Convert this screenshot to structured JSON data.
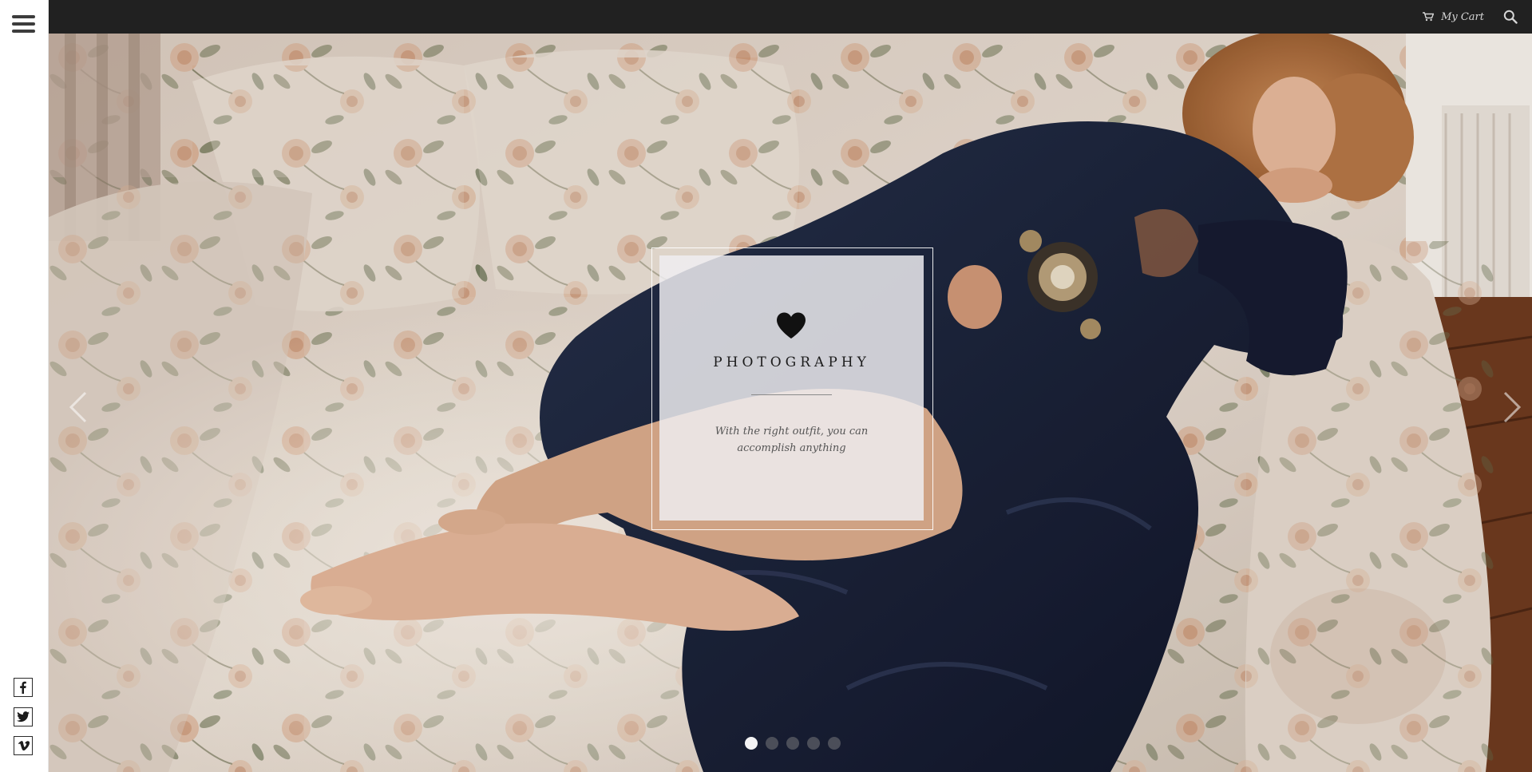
{
  "header": {
    "cart_label": "My Cart",
    "icons": [
      "menu-icon",
      "cart-icon",
      "search-icon"
    ],
    "bar_color": "#212121"
  },
  "sidebar": {
    "social": [
      {
        "name": "facebook",
        "icon": "facebook-icon"
      },
      {
        "name": "twitter",
        "icon": "twitter-icon"
      },
      {
        "name": "vimeo",
        "icon": "vimeo-icon"
      }
    ]
  },
  "slider": {
    "slide": {
      "icon": "heart-icon",
      "title": "PHOTOGRAPHY",
      "caption": "With the right outfit, you can accomplish anything"
    },
    "slide_count": 5,
    "active_index": 0,
    "prev_icon": "chevron-left-icon",
    "next_icon": "chevron-right-icon"
  }
}
